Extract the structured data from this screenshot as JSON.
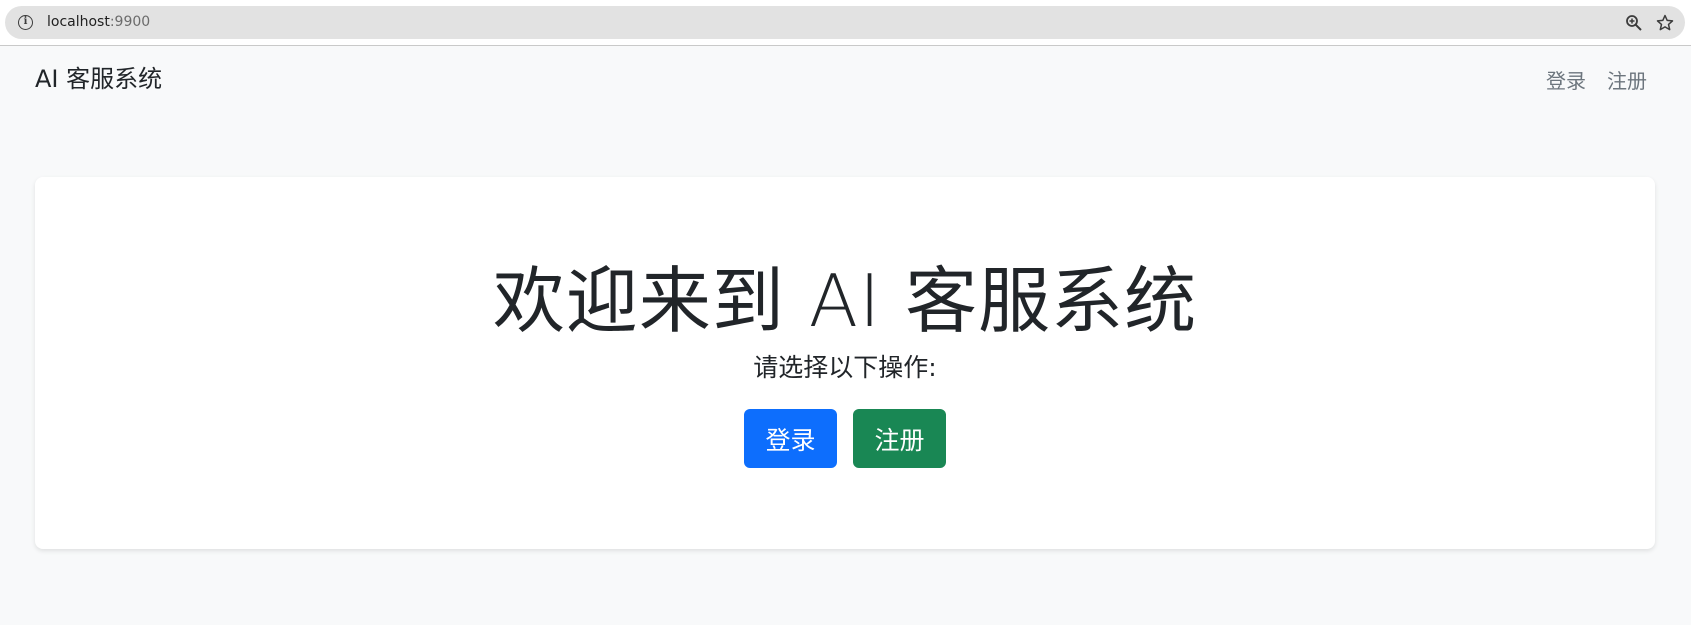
{
  "browser": {
    "url_host": "localhost",
    "url_port": ":9900",
    "icons": [
      "info-icon",
      "zoom-icon",
      "star-icon"
    ]
  },
  "navbar": {
    "brand": "AI 客服系统",
    "links": [
      {
        "label": "登录"
      },
      {
        "label": "注册"
      }
    ]
  },
  "hero": {
    "title": "欢迎来到 AI 客服系统",
    "subtitle": "请选择以下操作:",
    "buttons": [
      {
        "label": "登录",
        "color": "#0d6efd"
      },
      {
        "label": "注册",
        "color": "#198754"
      }
    ]
  },
  "colors": {
    "background": "#f8f9fa",
    "card": "#ffffff",
    "primary": "#0d6efd",
    "success": "#198754",
    "muted": "#6c757d"
  }
}
